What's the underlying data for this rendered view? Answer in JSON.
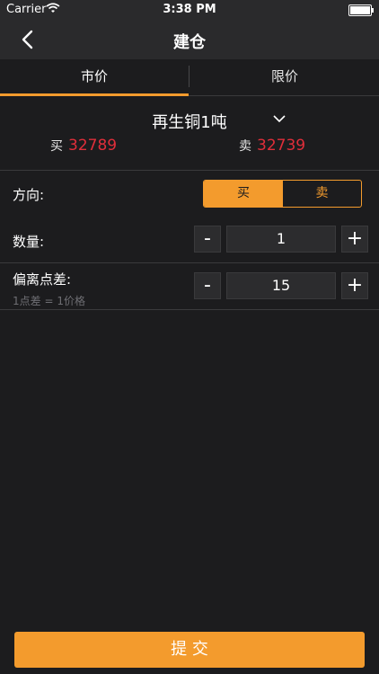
{
  "status_bar": {
    "carrier": "Carrier",
    "time": "3:38 PM"
  },
  "nav": {
    "title": "建仓",
    "back_icon": "chevron-left-icon"
  },
  "tabs": [
    {
      "label": "市价",
      "active": true
    },
    {
      "label": "限价",
      "active": false
    }
  ],
  "product": {
    "name": "再生铜1吨",
    "buy_label": "买",
    "buy_price": "32789",
    "sell_label": "卖",
    "sell_price": "32739"
  },
  "direction": {
    "label": "方向:",
    "options": [
      "买",
      "卖"
    ],
    "selected": "买"
  },
  "quantity": {
    "label": "数量:",
    "value": "1",
    "minus": "-",
    "plus": "+"
  },
  "deviation": {
    "label": "偏离点差:",
    "hint": "1点差 = 1价格",
    "value": "15",
    "minus": "-",
    "plus": "+"
  },
  "submit": {
    "label": "提 交"
  },
  "colors": {
    "accent": "#f39b2d",
    "price": "#e02e3a",
    "background": "#1c1c1e"
  }
}
